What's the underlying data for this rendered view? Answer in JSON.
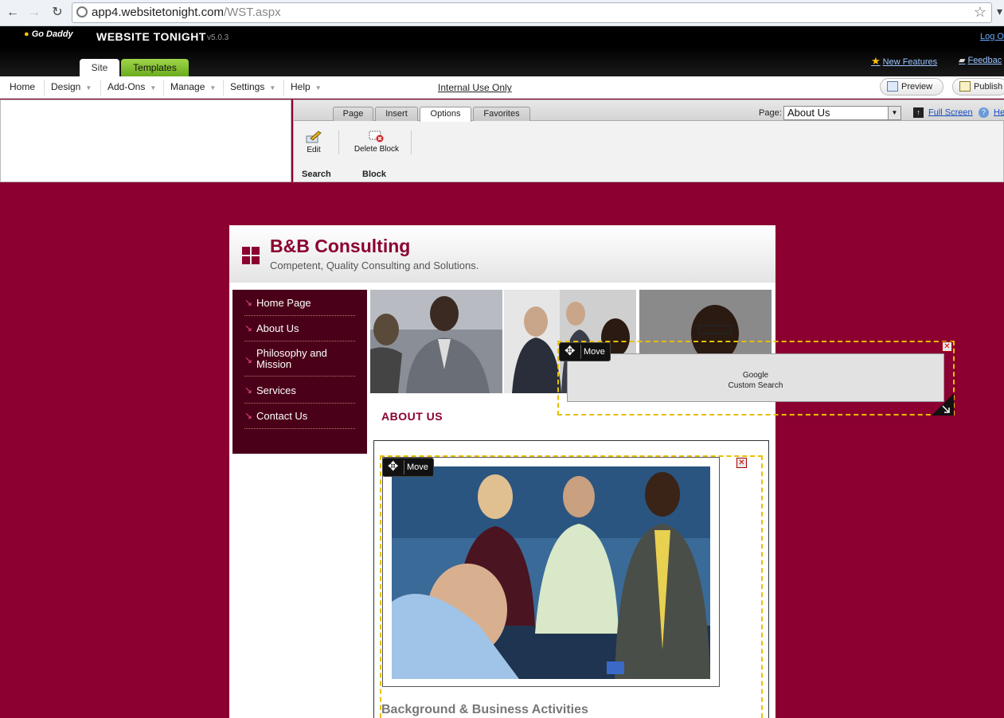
{
  "browser": {
    "back_icon": "back-arrow-icon",
    "forward_icon": "forward-arrow-icon",
    "reload_icon": "reload-icon",
    "url_host": "app4.websitetonight.com",
    "url_path": "/WST.aspx"
  },
  "app": {
    "brand": "Go Daddy",
    "title": "WEBSITE TONIGHT",
    "version": "v5.0.3",
    "logout": "Log O",
    "tabs": [
      "Site",
      "Templates"
    ],
    "new_features": "New Features",
    "feedback": "Feedbac"
  },
  "menu": {
    "items": [
      "Home",
      "Design",
      "Add-Ons",
      "Manage",
      "Settings",
      "Help"
    ],
    "internal": "Internal Use Only",
    "preview": "Preview",
    "publish": "Publish"
  },
  "editor": {
    "tabs": [
      "Page",
      "Insert",
      "Options",
      "Favorites"
    ],
    "active_tab": "Options",
    "page_label": "Page:",
    "page_value": "About Us",
    "full_screen": "Full Screen",
    "help": "He",
    "tools": {
      "edit": "Edit",
      "delete_block": "Delete Block"
    },
    "groups": {
      "search": "Search",
      "block": "Block"
    }
  },
  "site": {
    "title": "B&B Consulting",
    "tagline": "Competent, Quality Consulting and Solutions.",
    "nav": [
      "Home Page",
      "About Us",
      "Philosophy and Mission",
      "Services",
      "Contact Us"
    ],
    "about_heading": "ABOUT US",
    "section_title": "Background & Business Activities"
  },
  "blocks": {
    "move_label": "Move",
    "google_line1": "Google",
    "google_line2": "Custom Search"
  },
  "colors": {
    "brand": "#8b0030",
    "nav_bg": "#4a0018",
    "highlight": "#e8c000"
  }
}
